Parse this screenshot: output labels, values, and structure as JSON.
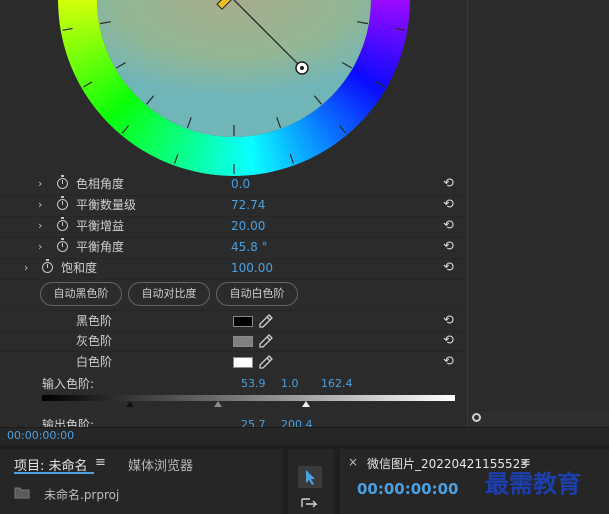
{
  "effects": {
    "hue_properties": [
      {
        "label": "色相角度",
        "value": "0.0"
      },
      {
        "label": "平衡数量级",
        "value": "72.74"
      },
      {
        "label": "平衡增益",
        "value": "20.00"
      },
      {
        "label": "平衡角度",
        "value": "45.8 °"
      }
    ],
    "saturation": {
      "label": "饱和度",
      "value": "100.00"
    },
    "auto_buttons": [
      "自动黑色阶",
      "自动对比度",
      "自动白色阶"
    ],
    "level_colors": [
      {
        "label": "黑色阶",
        "color": "#000000"
      },
      {
        "label": "灰色阶",
        "color": "#808080"
      },
      {
        "label": "白色阶",
        "color": "#ffffff"
      }
    ],
    "input_levels": {
      "label": "输入色阶:",
      "black": "53.9",
      "gamma": "1.0",
      "white": "162.4"
    },
    "output_levels": {
      "label": "输出色阶:",
      "black": "25.7",
      "white": "200.4"
    }
  },
  "timecode": "00:00:00:00",
  "project_panel": {
    "tab_project": "项目: 未命名",
    "tab_media_browser": "媒体浏览器",
    "file_name": "未命名.prproj"
  },
  "program_panel": {
    "tab_title": "微信图片_20220421155523",
    "timecode": "00:00:00:00"
  },
  "watermark": "最需教育",
  "colors": {
    "accent": "#4aa0e0",
    "panel": "#2b2b2b",
    "background": "#232323"
  }
}
